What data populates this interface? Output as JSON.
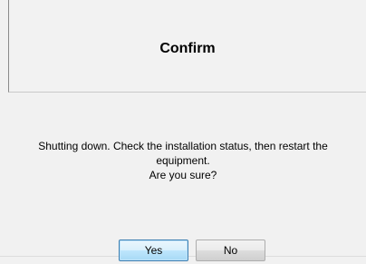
{
  "dialog": {
    "title": "Confirm",
    "message_lines": [
      "Shutting down. Check the installation status, then restart the",
      "equipment.",
      "Are you sure?"
    ],
    "buttons": {
      "yes_label": "Yes",
      "no_label": "No"
    }
  },
  "colors": {
    "background": "#f1f1f1",
    "default_button_border": "#3c7fb1"
  }
}
